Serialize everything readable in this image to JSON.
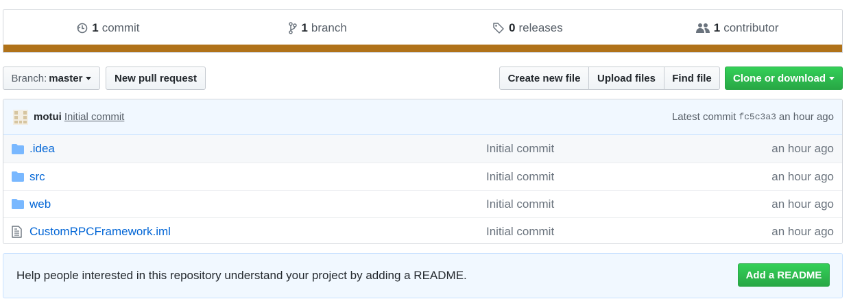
{
  "summary": {
    "commits": {
      "count": "1",
      "label": "commit",
      "icon": "history-icon"
    },
    "branches": {
      "count": "1",
      "label": "branch",
      "icon": "git-branch-icon"
    },
    "releases": {
      "count": "0",
      "label": "releases",
      "icon": "tag-icon"
    },
    "contributors": {
      "count": "1",
      "label": "contributor",
      "icon": "people-icon"
    },
    "language_color": "#b07219"
  },
  "toolbar": {
    "branch_prefix": "Branch:",
    "branch_name": "master",
    "new_pull_request": "New pull request",
    "create_new_file": "Create new file",
    "upload_files": "Upload files",
    "find_file": "Find file",
    "clone_or_download": "Clone or download"
  },
  "latest_commit": {
    "author": "motui",
    "message": "Initial commit",
    "prefix": "Latest commit",
    "sha": "fc5c3a3",
    "age": "an hour ago"
  },
  "files": [
    {
      "type": "directory",
      "icon": "folder-icon",
      "name": ".idea",
      "message": "Initial commit",
      "age": "an hour ago"
    },
    {
      "type": "directory",
      "icon": "folder-icon",
      "name": "src",
      "message": "Initial commit",
      "age": "an hour ago"
    },
    {
      "type": "directory",
      "icon": "folder-icon",
      "name": "web",
      "message": "Initial commit",
      "age": "an hour ago"
    },
    {
      "type": "file",
      "icon": "file-icon",
      "name": "CustomRPCFramework.iml",
      "message": "Initial commit",
      "age": "an hour ago"
    }
  ],
  "readme_banner": {
    "text": "Help people interested in this repository understand your project by adding a README.",
    "button": "Add a README"
  },
  "colors": {
    "link": "#0366d6",
    "primary_button": "#28a745",
    "banner_bg": "#f1f8ff"
  }
}
